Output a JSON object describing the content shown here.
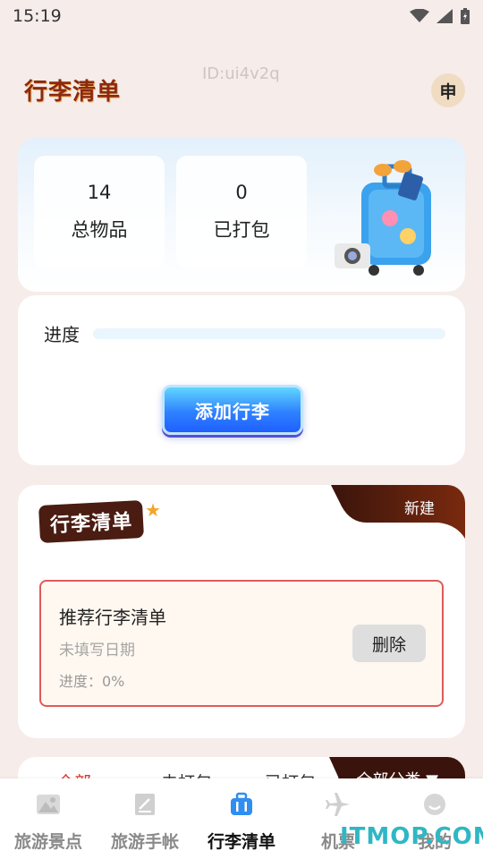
{
  "status_bar": {
    "time": "15:19"
  },
  "header": {
    "logo_text": "行李清单",
    "user_id": "ID:ui4v2q",
    "avatar_char": "申"
  },
  "stats": {
    "total_value": "14",
    "total_label": "总物品",
    "packed_value": "0",
    "packed_label": "已打包"
  },
  "progress": {
    "label": "进度",
    "fraction": 0.0
  },
  "actions": {
    "add_luggage": "添加行李"
  },
  "list_section": {
    "logo_text": "行李清单",
    "new_label": "新建",
    "item": {
      "title": "推荐行李清单",
      "date": "未填写日期",
      "progress": "进度：0%",
      "delete_label": "删除"
    }
  },
  "filter": {
    "tabs": [
      "全部",
      "未打包",
      "已打包"
    ],
    "dropdown_label": "全部分类 ▼"
  },
  "nav": {
    "items": [
      {
        "label": "旅游景点",
        "icon": "mountain-icon"
      },
      {
        "label": "旅游手帐",
        "icon": "notebook-icon"
      },
      {
        "label": "行李清单",
        "icon": "suitcase-icon"
      },
      {
        "label": "机票",
        "icon": "airplane-icon"
      },
      {
        "label": "我的",
        "icon": "profile-icon"
      }
    ]
  },
  "watermark": "ITMOP.COM",
  "colors": {
    "accent_blue": "#2f82ff",
    "accent_red": "#e0332b",
    "dark_brown": "#4a1c12",
    "item_border": "#e05a5a"
  }
}
